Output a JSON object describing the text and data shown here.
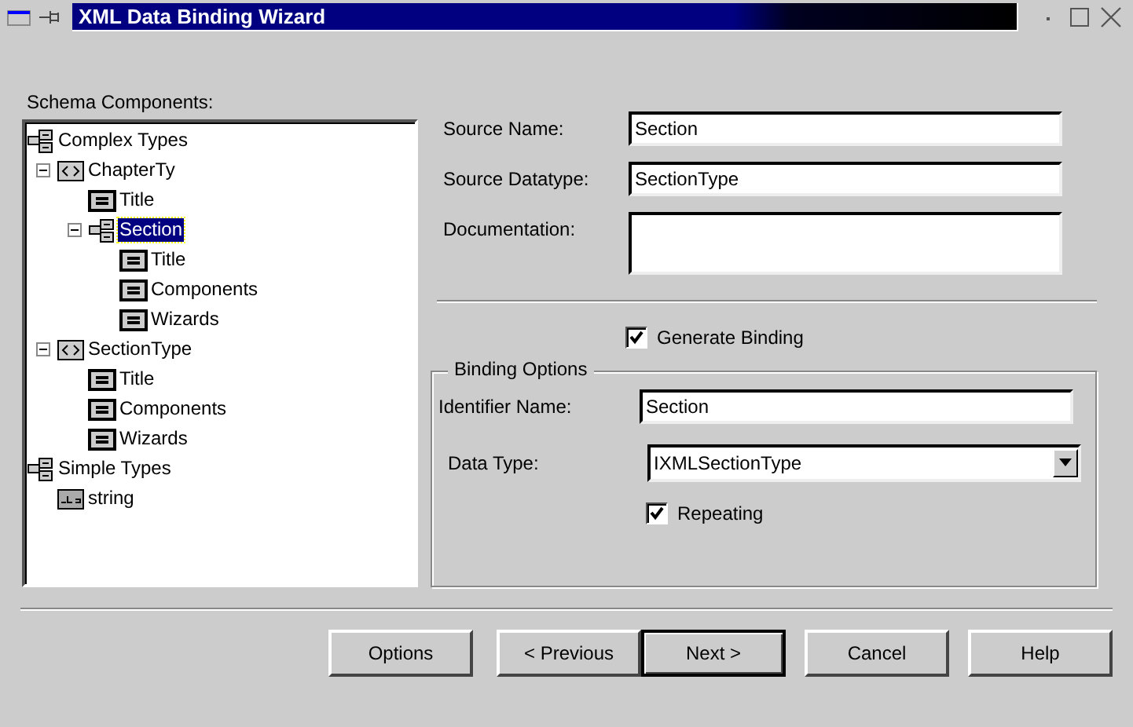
{
  "window": {
    "title": "XML Data Binding Wizard"
  },
  "schema": {
    "label": "Schema Components:",
    "tree": [
      {
        "label": "Complex Types",
        "kind": "group",
        "selected": false,
        "children": [
          {
            "label": "ChapterTy",
            "kind": "complex",
            "selected": false,
            "expanded": true,
            "children": [
              {
                "label": "Title",
                "kind": "element",
                "selected": false
              },
              {
                "label": "Section",
                "kind": "group",
                "selected": true,
                "expanded": true,
                "children": [
                  {
                    "label": "Title",
                    "kind": "element",
                    "selected": false
                  },
                  {
                    "label": "Components",
                    "kind": "element",
                    "selected": false
                  },
                  {
                    "label": "Wizards",
                    "kind": "element",
                    "selected": false
                  }
                ]
              }
            ]
          },
          {
            "label": "SectionType",
            "kind": "complex",
            "selected": false,
            "expanded": true,
            "children": [
              {
                "label": "Title",
                "kind": "element",
                "selected": false
              },
              {
                "label": "Components",
                "kind": "element",
                "selected": false
              },
              {
                "label": "Wizards",
                "kind": "element",
                "selected": false
              }
            ]
          }
        ]
      },
      {
        "label": "Simple Types",
        "kind": "group",
        "selected": false,
        "children": [
          {
            "label": "string",
            "kind": "simple",
            "selected": false
          }
        ]
      }
    ]
  },
  "fields": [
    {
      "kind": "text",
      "label": "Source Name:",
      "value": "Section"
    },
    {
      "kind": "text",
      "label": "Source Datatype:",
      "value": "SectionType"
    },
    {
      "kind": "memo",
      "label": "Documentation:"
    }
  ],
  "generate_binding": {
    "label": "Generate Binding",
    "checked": true
  },
  "binding_options": {
    "title": "Binding Options",
    "identifier": {
      "label": "Identifier Name:",
      "value": "Section"
    },
    "data_type": {
      "label": "Data Type:",
      "value": "IXMLSectionType"
    },
    "repeating": {
      "label": "Repeating",
      "checked": true
    }
  },
  "buttons": [
    {
      "label": "Options",
      "default": false
    },
    {
      "label": "< Previous",
      "default": false
    },
    {
      "label": "Next >",
      "default": true
    },
    {
      "label": "Cancel",
      "default": false
    },
    {
      "label": "Help",
      "default": false
    }
  ]
}
